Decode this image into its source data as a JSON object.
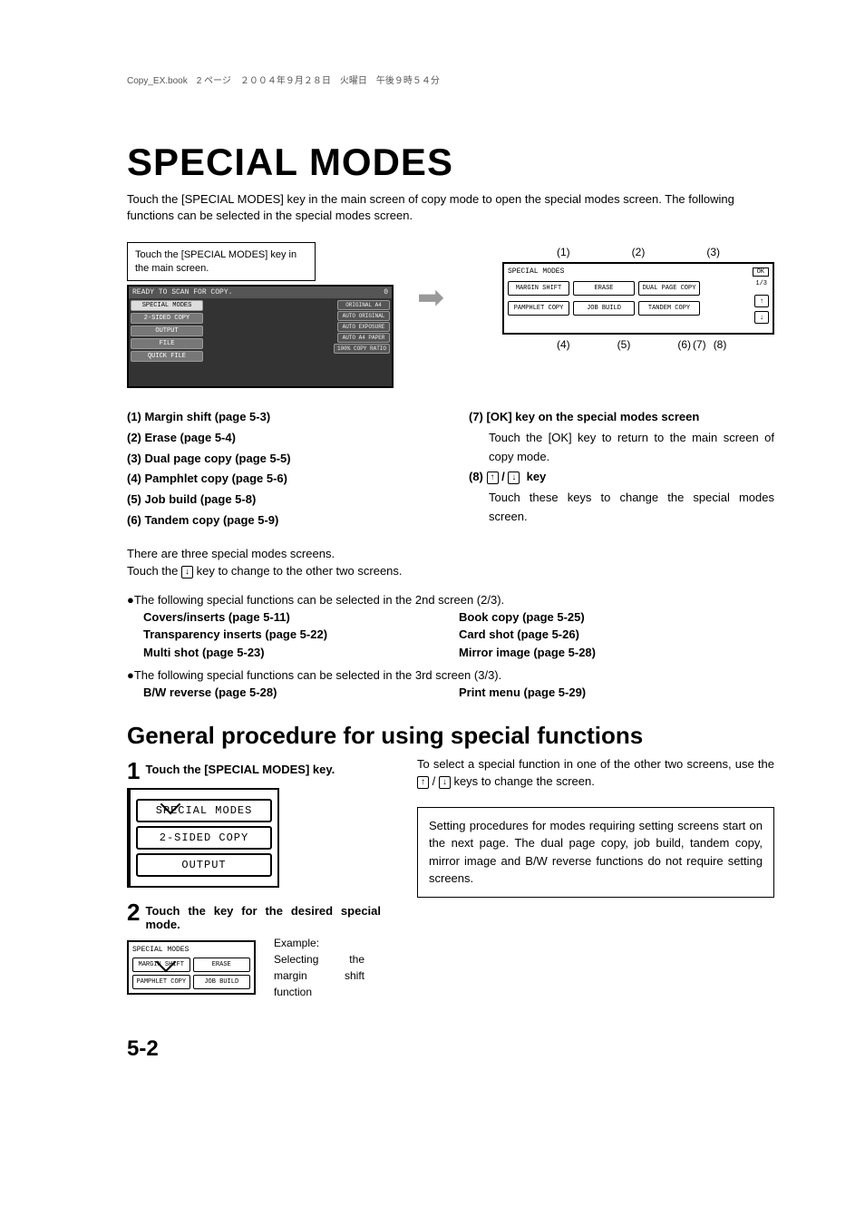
{
  "meta": {
    "header": "Copy_EX.book　2 ページ　２００４年９月２８日　火曜日　午後９時５４分"
  },
  "title": "SPECIAL MODES",
  "intro": "Touch the [SPECIAL MODES] key in the main screen of copy mode to open the special modes screen. The following functions can be selected in the special modes screen.",
  "callout": "Touch the [SPECIAL MODES] key in the main screen.",
  "main_screen": {
    "topbar_left": "READY TO SCAN FOR COPY.",
    "topbar_right": "0",
    "keys": [
      "SPECIAL MODES",
      "2-SIDED COPY",
      "OUTPUT",
      "FILE",
      "QUICK FILE"
    ],
    "right": [
      "ORIGINAL  A4",
      "AUTO ORIGINAL",
      "AUTO EXPOSURE",
      "AUTO  A4 PAPER",
      "100% COPY RATIO"
    ],
    "tray": "A4"
  },
  "labels_top": [
    "(1)",
    "(2)",
    "(3)"
  ],
  "labels_bottom": [
    "(4)",
    "(5)",
    "(6)",
    "(7)",
    "(8)"
  ],
  "sm_screen": {
    "title": "SPECIAL MODES",
    "ok": "OK",
    "pg": "1/3",
    "row1": [
      "MARGIN SHIFT",
      "ERASE",
      "DUAL PAGE COPY"
    ],
    "row2": [
      "PAMPHLET COPY",
      "JOB BUILD",
      "TANDEM COPY"
    ]
  },
  "list_left": [
    "(1)  Margin shift (page 5-3)",
    "(2)  Erase (page 5-4)",
    "(3)  Dual page copy (page 5-5)",
    "(4)  Pamphlet copy (page 5-6)",
    "(5)  Job build (page 5-8)",
    "(6)  Tandem copy (page 5-9)"
  ],
  "list_right": {
    "item7": "(7)  [OK] key on the special modes screen",
    "item7_sub": "Touch the [OK] key to return to the main screen of copy mode.",
    "item8_a": "(8)",
    "item8_b": "key",
    "item8_sub": "Touch these keys to change the special modes screen."
  },
  "note1a": "There are three special modes screens.",
  "note1b_a": "Touch the ",
  "note1b_b": " key to change to the other two screens.",
  "screen2_lead": "●The following special functions can be selected in the 2nd screen (2/3).",
  "screen2_left": [
    "Covers/inserts (page 5-11)",
    "Transparency inserts (page 5-22)",
    "Multi shot (page 5-23)"
  ],
  "screen2_right": [
    "Book copy (page 5-25)",
    "Card shot (page 5-26)",
    "Mirror image (page 5-28)"
  ],
  "screen3_lead": "●The following special functions can be selected in the 3rd screen (3/3).",
  "screen3_left": [
    "B/W reverse (page 5-28)"
  ],
  "screen3_right": [
    "Print menu (page 5-29)"
  ],
  "subtitle": "General procedure for using special functions",
  "step1": {
    "num": "1",
    "txt": "Touch the [SPECIAL MODES] key."
  },
  "ms2": {
    "k1": "SPECIAL MODES",
    "k2": "2-SIDED COPY",
    "k3": "OUTPUT"
  },
  "proc_right_a": "To select a special function in one of the other two screens, use the ",
  "proc_right_b": " keys to change the screen.",
  "info_box": "Setting procedures for modes requiring setting screens start on the next page.\nThe dual page copy, job build, tandem copy, mirror image and B/W reverse functions do not require setting screens.",
  "step2": {
    "num": "2",
    "txt": "Touch the key for the desired special mode."
  },
  "ms3": {
    "title": "SPECIAL MODES",
    "row1": [
      "MARGIN SHIFT",
      "ERASE"
    ],
    "row2": [
      "PAMPHLET COPY",
      "JOB BUILD"
    ]
  },
  "example": "Example:\nSelecting the margin shift function",
  "page_num": "5-2",
  "glyph_up": "↑",
  "glyph_down": "↓",
  "slash": " / "
}
